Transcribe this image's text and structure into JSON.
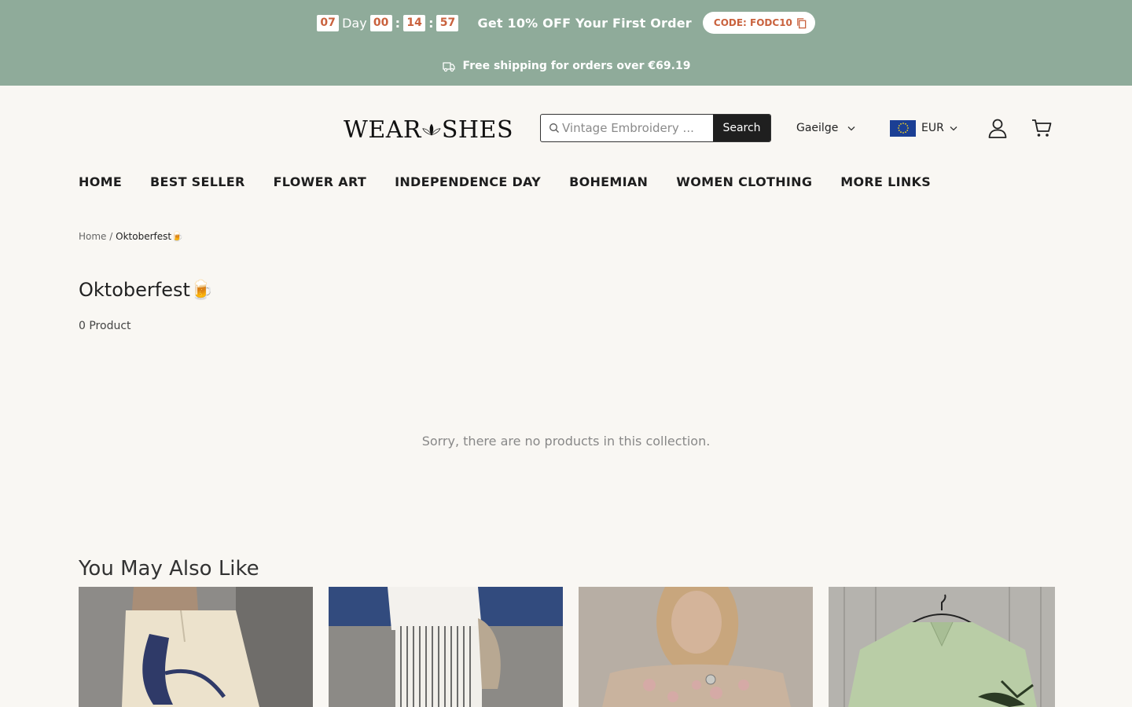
{
  "announcement": {
    "countdown": {
      "days": "07",
      "day_label": "Day",
      "hours": "00",
      "minutes": "14",
      "seconds": "57"
    },
    "promo_text": "Get 10% OFF Your First Order",
    "code_label": "CODE: FODC10",
    "shipping_text": "Free shipping for orders over €69.19"
  },
  "header": {
    "logo_text_left": "WEAR",
    "logo_text_right": "SHES",
    "search": {
      "placeholder": "Vintage Embroidery ...",
      "button_label": "Search"
    },
    "language": "Gaeilge",
    "currency": "EUR"
  },
  "nav": {
    "items": [
      {
        "label": "HOME"
      },
      {
        "label": "BEST SELLER"
      },
      {
        "label": "FLOWER ART"
      },
      {
        "label": "INDEPENDENCE DAY"
      },
      {
        "label": "BOHEMIAN"
      },
      {
        "label": "WOMEN CLOTHING"
      },
      {
        "label": "MORE LINKS"
      }
    ]
  },
  "breadcrumb": {
    "home": "Home",
    "separator": "/",
    "current": "Oktoberfest🍺"
  },
  "collection": {
    "title": "Oktoberfest🍺",
    "count": "0 Product",
    "empty_message": "Sorry, there are no products in this collection."
  },
  "recommendations": {
    "title": "You May Also Like",
    "products": [
      {
        "icon": "octopus-print-pants-image"
      },
      {
        "icon": "striped-linen-pants-image"
      },
      {
        "icon": "floral-lace-top-image"
      },
      {
        "icon": "green-linen-shirt-image"
      }
    ]
  },
  "colors": {
    "promo_bg": "#8fab9a",
    "accent": "#c9623e",
    "page_bg": "#f9f7f3",
    "search_button": "#1f1f1f"
  }
}
